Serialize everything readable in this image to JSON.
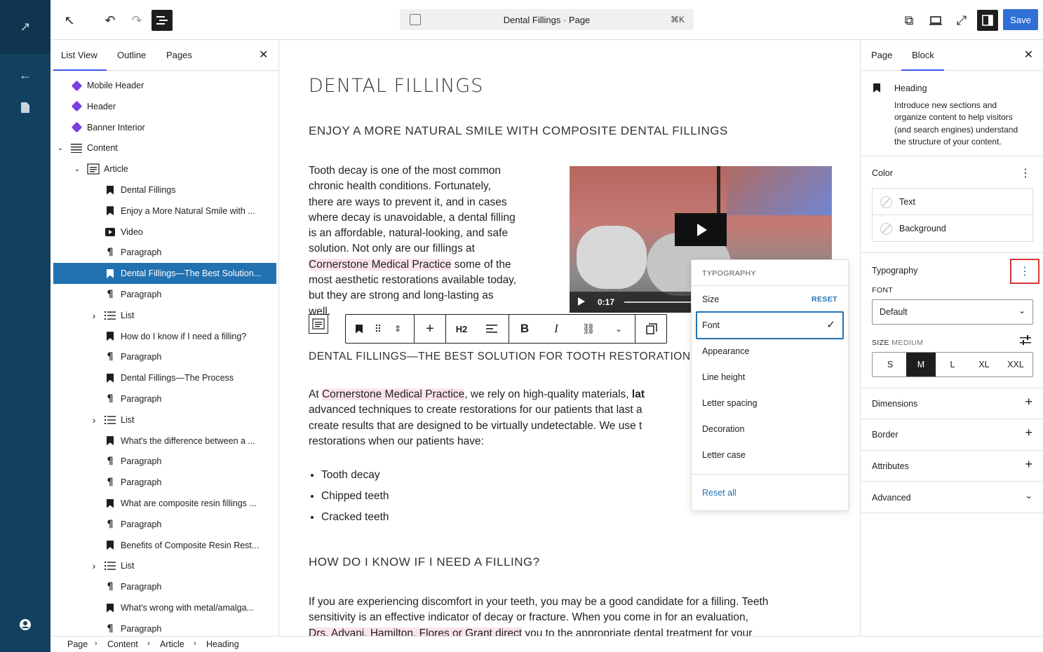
{
  "topbar": {
    "doc_title": "Dental Fillings · Page",
    "shortcut": "⌘K",
    "save_label": "Save"
  },
  "listpanel": {
    "tabs": [
      "List View",
      "Outline",
      "Pages"
    ],
    "rows": [
      {
        "label": "Mobile Header",
        "icon": "diamond-icon"
      },
      {
        "label": "Header",
        "icon": "diamond-icon"
      },
      {
        "label": "Banner Interior",
        "icon": "diamond-icon"
      },
      {
        "label": "Content",
        "icon": "group-icon"
      },
      {
        "label": "Article",
        "icon": "article-icon"
      },
      {
        "label": "Dental Fillings",
        "icon": "heading-icon"
      },
      {
        "label": "Enjoy a More Natural Smile with ...",
        "icon": "heading-icon"
      },
      {
        "label": "Video",
        "icon": "video-icon"
      },
      {
        "label": "Paragraph",
        "icon": "paragraph-icon"
      },
      {
        "label": "Dental Fillings—The Best Solution...",
        "icon": "heading-icon"
      },
      {
        "label": "Paragraph",
        "icon": "paragraph-icon"
      },
      {
        "label": "List",
        "icon": "list-icon"
      },
      {
        "label": "How do I know if I need a filling?",
        "icon": "heading-icon"
      },
      {
        "label": "Paragraph",
        "icon": "paragraph-icon"
      },
      {
        "label": "Dental Fillings—The Process",
        "icon": "heading-icon"
      },
      {
        "label": "Paragraph",
        "icon": "paragraph-icon"
      },
      {
        "label": "List",
        "icon": "list-icon"
      },
      {
        "label": "What's the difference between a ...",
        "icon": "heading-icon"
      },
      {
        "label": "Paragraph",
        "icon": "paragraph-icon"
      },
      {
        "label": "Paragraph",
        "icon": "paragraph-icon"
      },
      {
        "label": "What are composite resin fillings ...",
        "icon": "heading-icon"
      },
      {
        "label": "Paragraph",
        "icon": "paragraph-icon"
      },
      {
        "label": "Benefits of Composite Resin Rest...",
        "icon": "heading-icon"
      },
      {
        "label": "List",
        "icon": "list-icon"
      },
      {
        "label": "Paragraph",
        "icon": "paragraph-icon"
      },
      {
        "label": "What's wrong with metal/amalga...",
        "icon": "heading-icon"
      },
      {
        "label": "Paragraph",
        "icon": "paragraph-icon"
      }
    ]
  },
  "canvas": {
    "h1": "DENTAL FILLINGS",
    "h2a": "ENJOY A MORE NATURAL SMILE WITH COMPOSITE DENTAL FILLINGS",
    "p1": [
      "Tooth decay is one of the most common",
      "chronic health conditions. Fortunately,",
      "there are ways to prevent it, and in cases",
      "where decay is unavoidable, a dental filling",
      "is an affordable, natural-looking, and safe",
      "solution. Not only are our fillings at"
    ],
    "p1_hl": "Cornerstone Medical Practice",
    "p1_after": " some of the",
    "p1_rest": [
      "most aesthetic restorations available today,",
      "but they are strong and long-lasting as",
      "well."
    ],
    "video_time": "0:17",
    "toolbar_h2": "H2",
    "h2b": "DENTAL FILLINGS—THE BEST SOLUTION FOR TOOTH RESTORATION",
    "p2_pre": "At ",
    "p2_hl": "Cornerstone Medical Practice",
    "p2_after": ", we rely on high-quality materials, ",
    "p2_bold": "lat",
    "p2_lines": [
      "advanced techniques to create restorations for our patients that last a",
      "create results that are designed to be virtually undetectable. We use t",
      "restorations when our patients have:"
    ],
    "bullets": [
      "Tooth decay",
      "Chipped teeth",
      "Cracked teeth"
    ],
    "h2c": "HOW DO I KNOW IF I NEED A FILLING?",
    "p3_lines": [
      "If you are experiencing discomfort in your teeth, you may be a good candidate for a filling. Teeth",
      "sensitivity is an effective indicator of decay or fracture. When you come in for an evaluation,"
    ],
    "p3_hl": "Drs. Advani, Hamilton, Flores or Grant direct",
    "p3_after": " you to the appropriate dental treatment for your"
  },
  "typo_menu": {
    "header": "TYPOGRAPHY",
    "size": "Size",
    "reset": "RESET",
    "items": [
      "Font",
      "Appearance",
      "Line height",
      "Letter spacing",
      "Decoration",
      "Letter case"
    ],
    "reset_all": "Reset all"
  },
  "sidebar": {
    "tabs": [
      "Page",
      "Block"
    ],
    "block_name": "Heading",
    "block_desc": [
      "Introduce new sections and",
      "organize content to help visitors",
      "(and search engines) understand",
      "the structure of your content."
    ],
    "color_title": "Color",
    "color_items": [
      "Text",
      "Background"
    ],
    "typography_title": "Typography",
    "font_label": "FONT",
    "font_value": "Default",
    "size_label": "SIZE",
    "size_value": "MEDIUM",
    "sizes": [
      "S",
      "M",
      "L",
      "XL",
      "XXL"
    ],
    "sections": [
      "Dimensions",
      "Border",
      "Attributes",
      "Advanced"
    ]
  },
  "breadcrumb": [
    "Page",
    "Content",
    "Article",
    "Heading"
  ],
  "colors": {
    "accent": "#3858e9",
    "selected": "#2271b1",
    "rail": "#124160",
    "highlight": "#fce4ea"
  }
}
